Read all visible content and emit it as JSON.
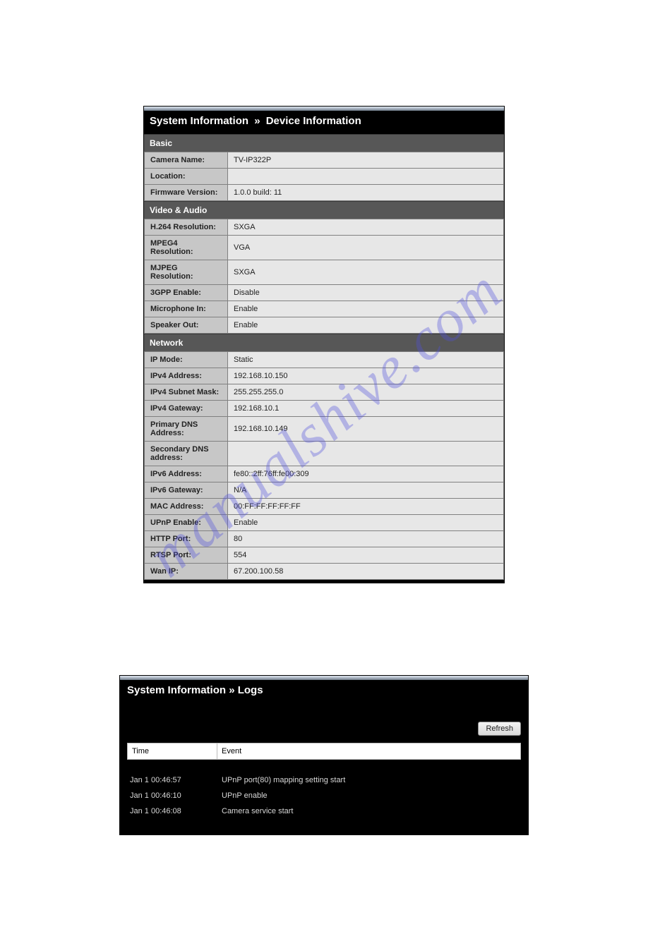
{
  "watermark": "manualshive.com",
  "deviceInfo": {
    "breadcrumb1": "System Information",
    "breadcrumbSep": "»",
    "breadcrumb2": "Device Information",
    "sections": {
      "basic": {
        "title": "Basic",
        "rows": [
          {
            "label": "Camera Name:",
            "value": "TV-IP322P"
          },
          {
            "label": "Location:",
            "value": ""
          },
          {
            "label": "Firmware Version:",
            "value": "1.0.0 build: 11"
          }
        ]
      },
      "videoAudio": {
        "title": "Video & Audio",
        "rows": [
          {
            "label": "H.264 Resolution:",
            "value": "SXGA"
          },
          {
            "label": "MPEG4 Resolution:",
            "value": "VGA"
          },
          {
            "label": "MJPEG Resolution:",
            "value": "SXGA"
          },
          {
            "label": "3GPP Enable:",
            "value": "Disable"
          },
          {
            "label": "Microphone In:",
            "value": "Enable"
          },
          {
            "label": "Speaker Out:",
            "value": "Enable"
          }
        ]
      },
      "network": {
        "title": "Network",
        "rows": [
          {
            "label": "IP Mode:",
            "value": "Static"
          },
          {
            "label": "IPv4 Address:",
            "value": "192.168.10.150"
          },
          {
            "label": "IPv4 Subnet Mask:",
            "value": "255.255.255.0"
          },
          {
            "label": "IPv4 Gateway:",
            "value": "192.168.10.1"
          },
          {
            "label": "Primary DNS Address:",
            "value": "192.168.10.149"
          },
          {
            "label": "Secondary DNS address:",
            "value": ""
          },
          {
            "label": "IPv6 Address:",
            "value": "fe80::2ff:76ff:fe00:309"
          },
          {
            "label": "IPv6 Gateway:",
            "value": "N/A"
          },
          {
            "label": "MAC Address:",
            "value": "00:FF:FF:FF:FF:FF"
          },
          {
            "label": "UPnP Enable:",
            "value": "Enable"
          },
          {
            "label": "HTTP Port:",
            "value": "80"
          },
          {
            "label": "RTSP Port:",
            "value": "554"
          },
          {
            "label": "Wan IP:",
            "value": "67.200.100.58"
          }
        ]
      }
    }
  },
  "logs": {
    "breadcrumb1": "System Information",
    "breadcrumbSep": "»",
    "breadcrumb2": "Logs",
    "refreshLabel": "Refresh",
    "columns": {
      "time": "Time",
      "event": "Event"
    },
    "rows": [
      {
        "time": "Jan  1 00:46:57",
        "event": "UPnP port(80) mapping setting start"
      },
      {
        "time": "Jan  1 00:46:10",
        "event": "UPnP enable"
      },
      {
        "time": "Jan  1 00:46:08",
        "event": "Camera service start"
      }
    ]
  }
}
